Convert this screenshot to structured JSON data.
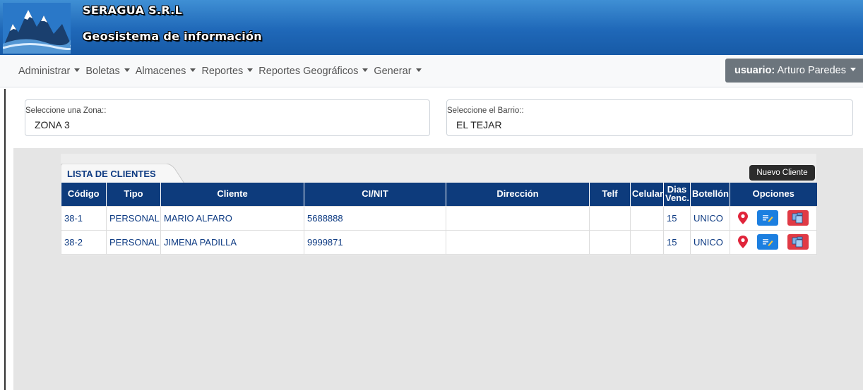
{
  "header": {
    "title": "SERAGUA S.R.L",
    "subtitle": "Geosistema de información",
    "logo_icon": "mountains-logo-icon"
  },
  "navbar": {
    "menu": [
      {
        "label": "Administrar"
      },
      {
        "label": "Boletas"
      },
      {
        "label": "Almacenes"
      },
      {
        "label": "Reportes"
      },
      {
        "label": "Reportes Geográficos"
      },
      {
        "label": "Generar"
      }
    ],
    "user_prefix": "usuario:",
    "user_name": "Arturo Paredes"
  },
  "filters": {
    "zone_label": "Seleccione una Zona::",
    "zone_value": "ZONA 3",
    "barrio_label": "Seleccione el Barrio::",
    "barrio_value": "EL TEJAR"
  },
  "clients": {
    "tab_label": "LISTA DE CLIENTES",
    "new_client_tooltip": "Nuevo Cliente",
    "columns": [
      "Código",
      "Tipo",
      "Cliente",
      "CI/NIT",
      "Dirección",
      "Telf",
      "Celular",
      "Dias Venc.",
      "Botellón",
      "Opciones"
    ],
    "rows": [
      {
        "codigo": "38-1",
        "tipo": "PERSONAL",
        "cliente": "MARIO ALFARO",
        "ci": "5688888",
        "direccion": "",
        "telf": "",
        "celular": "",
        "dias": "15",
        "botellon": "UNICO"
      },
      {
        "codigo": "38-2",
        "tipo": "PERSONAL",
        "cliente": "JIMENA PADILLA",
        "ci": "9999871",
        "direccion": "",
        "telf": "",
        "celular": "",
        "dias": "15",
        "botellon": "UNICO"
      }
    ],
    "option_icons": [
      "map-pin-icon",
      "edit-icon",
      "delete-icon"
    ],
    "colors": {
      "header_bg": "#0d3b7c",
      "edit_btn": "#1c7fe0",
      "delete_btn": "#e03a45",
      "pin": "#e0243a"
    }
  }
}
